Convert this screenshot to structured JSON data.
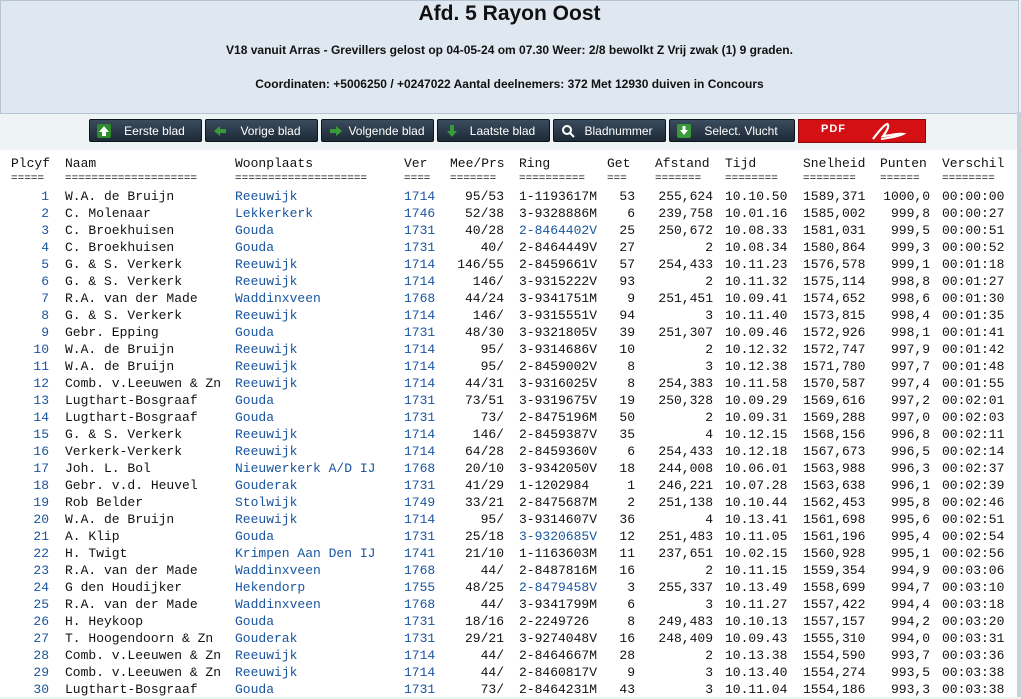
{
  "header": {
    "title": "Afd. 5 Rayon Oost",
    "line1": "V18 vanuit Arras - Grevillers gelost op 04-05-24 om 07.30 Weer: 2/8 bewolkt Z Vrij zwak (1) 9 graden.",
    "line2": "Coordinaten: +5006250 / +0247022 Aantal deelnemers: 372 Met 12930 duiven in Concours"
  },
  "toolbar": {
    "first": "Eerste blad",
    "prev": "Vorige blad",
    "next": "Volgende blad",
    "last": "Laatste blad",
    "page": "Bladnummer",
    "flight": "Select. Vlucht",
    "pdf": "PDF"
  },
  "table": {
    "columns": [
      "Plcyf",
      "Naam",
      "Woonplaats",
      "Ver",
      "Mee/Prs",
      "Ring",
      "Get",
      "Afstand",
      "Tijd",
      "Snelheid",
      "Punten",
      "Verschil"
    ],
    "separators": [
      "=====",
      "====================",
      "====================",
      "====",
      "=======",
      "==========",
      "===",
      "=======",
      "========",
      "========",
      "======",
      "========"
    ],
    "rows": [
      [
        "1",
        "W.A. de Bruijn",
        "Reeuwijk",
        "1714",
        "95/53",
        "1-1193617M",
        "53",
        "255,624",
        "10.10.50",
        "1589,371",
        "1000,0",
        "00:00:00"
      ],
      [
        "2",
        "C. Molenaar",
        "Lekkerkerk",
        "1746",
        "52/38",
        "3-9328886M",
        "6",
        "239,758",
        "10.01.16",
        "1585,002",
        "999,8",
        "00:00:27"
      ],
      [
        "3",
        "C. Broekhuisen",
        "Gouda",
        "1731",
        "40/28",
        "2-8464402V",
        "25",
        "250,672",
        "10.08.33",
        "1581,031",
        "999,5",
        "00:00:51"
      ],
      [
        "4",
        "C. Broekhuisen",
        "Gouda",
        "1731",
        "40/",
        "2-8464449V",
        "27",
        "2",
        "10.08.34",
        "1580,864",
        "999,3",
        "00:00:52"
      ],
      [
        "5",
        "G. & S. Verkerk",
        "Reeuwijk",
        "1714",
        "146/55",
        "2-8459661V",
        "57",
        "254,433",
        "10.11.23",
        "1576,578",
        "999,1",
        "00:01:18"
      ],
      [
        "6",
        "G. & S. Verkerk",
        "Reeuwijk",
        "1714",
        "146/",
        "3-9315222V",
        "93",
        "2",
        "10.11.32",
        "1575,114",
        "998,8",
        "00:01:27"
      ],
      [
        "7",
        "R.A. van der Made",
        "Waddinxveen",
        "1768",
        "44/24",
        "3-9341751M",
        "9",
        "251,451",
        "10.09.41",
        "1574,652",
        "998,6",
        "00:01:30"
      ],
      [
        "8",
        "G. & S. Verkerk",
        "Reeuwijk",
        "1714",
        "146/",
        "3-9315551V",
        "94",
        "3",
        "10.11.40",
        "1573,815",
        "998,4",
        "00:01:35"
      ],
      [
        "9",
        "Gebr. Epping",
        "Gouda",
        "1731",
        "48/30",
        "3-9321805V",
        "39",
        "251,307",
        "10.09.46",
        "1572,926",
        "998,1",
        "00:01:41"
      ],
      [
        "10",
        "W.A. de Bruijn",
        "Reeuwijk",
        "1714",
        "95/",
        "3-9314686V",
        "10",
        "2",
        "10.12.32",
        "1572,747",
        "997,9",
        "00:01:42"
      ],
      [
        "11",
        "W.A. de Bruijn",
        "Reeuwijk",
        "1714",
        "95/",
        "2-8459002V",
        "8",
        "3",
        "10.12.38",
        "1571,780",
        "997,7",
        "00:01:48"
      ],
      [
        "12",
        "Comb. v.Leeuwen & Zn",
        "Reeuwijk",
        "1714",
        "44/31",
        "3-9316025V",
        "8",
        "254,383",
        "10.11.58",
        "1570,587",
        "997,4",
        "00:01:55"
      ],
      [
        "13",
        "Lugthart-Bosgraaf",
        "Gouda",
        "1731",
        "73/51",
        "3-9319675V",
        "19",
        "250,328",
        "10.09.29",
        "1569,616",
        "997,2",
        "00:02:01"
      ],
      [
        "14",
        "Lugthart-Bosgraaf",
        "Gouda",
        "1731",
        "73/",
        "2-8475196M",
        "50",
        "2",
        "10.09.31",
        "1569,288",
        "997,0",
        "00:02:03"
      ],
      [
        "15",
        "G. & S. Verkerk",
        "Reeuwijk",
        "1714",
        "146/",
        "2-8459387V",
        "35",
        "4",
        "10.12.15",
        "1568,156",
        "996,8",
        "00:02:11"
      ],
      [
        "16",
        "Verkerk-Verkerk",
        "Reeuwijk",
        "1714",
        "64/28",
        "2-8459360V",
        "6",
        "254,433",
        "10.12.18",
        "1567,673",
        "996,5",
        "00:02:14"
      ],
      [
        "17",
        "Joh. L. Bol",
        "Nieuwerkerk A/D IJ",
        "1768",
        "20/10",
        "3-9342050V",
        "18",
        "244,008",
        "10.06.01",
        "1563,988",
        "996,3",
        "00:02:37"
      ],
      [
        "18",
        "Gebr. v.d. Heuvel",
        "Gouderak",
        "1731",
        "41/29",
        "1-1202984",
        "1",
        "246,221",
        "10.07.28",
        "1563,638",
        "996,1",
        "00:02:39"
      ],
      [
        "19",
        "Rob Belder",
        "Stolwijk",
        "1749",
        "33/21",
        "2-8475687M",
        "2",
        "251,138",
        "10.10.44",
        "1562,453",
        "995,8",
        "00:02:46"
      ],
      [
        "20",
        "W.A. de Bruijn",
        "Reeuwijk",
        "1714",
        "95/",
        "3-9314607V",
        "36",
        "4",
        "10.13.41",
        "1561,698",
        "995,6",
        "00:02:51"
      ],
      [
        "21",
        "A. Klip",
        "Gouda",
        "1731",
        "25/18",
        "3-9320685V",
        "12",
        "251,483",
        "10.11.05",
        "1561,196",
        "995,4",
        "00:02:54"
      ],
      [
        "22",
        "H. Twigt",
        "Krimpen Aan Den IJ",
        "1741",
        "21/10",
        "1-1163603M",
        "11",
        "237,651",
        "10.02.15",
        "1560,928",
        "995,1",
        "00:02:56"
      ],
      [
        "23",
        "R.A. van der Made",
        "Waddinxveen",
        "1768",
        "44/",
        "2-8487816M",
        "16",
        "2",
        "10.11.15",
        "1559,354",
        "994,9",
        "00:03:06"
      ],
      [
        "24",
        "G den Houdijker",
        "Hekendorp",
        "1755",
        "48/25",
        "2-8479458V",
        "3",
        "255,337",
        "10.13.49",
        "1558,699",
        "994,7",
        "00:03:10"
      ],
      [
        "25",
        "R.A. van der Made",
        "Waddinxveen",
        "1768",
        "44/",
        "3-9341799M",
        "6",
        "3",
        "10.11.27",
        "1557,422",
        "994,4",
        "00:03:18"
      ],
      [
        "26",
        "H. Heykoop",
        "Gouda",
        "1731",
        "18/16",
        "2-2249726",
        "8",
        "249,483",
        "10.10.13",
        "1557,157",
        "994,2",
        "00:03:20"
      ],
      [
        "27",
        "T. Hoogendoorn & Zn",
        "Gouderak",
        "1731",
        "29/21",
        "3-9274048V",
        "16",
        "248,409",
        "10.09.43",
        "1555,310",
        "994,0",
        "00:03:31"
      ],
      [
        "28",
        "Comb. v.Leeuwen & Zn",
        "Reeuwijk",
        "1714",
        "44/",
        "2-8464667M",
        "28",
        "2",
        "10.13.38",
        "1554,590",
        "993,7",
        "00:03:36"
      ],
      [
        "29",
        "Comb. v.Leeuwen & Zn",
        "Reeuwijk",
        "1714",
        "44/",
        "2-8460817V",
        "9",
        "3",
        "10.13.40",
        "1554,274",
        "993,5",
        "00:03:38"
      ],
      [
        "30",
        "Lugthart-Bosgraaf",
        "Gouda",
        "1731",
        "73/",
        "2-8464231M",
        "43",
        "3",
        "10.11.04",
        "1554,186",
        "993,3",
        "00:03:38"
      ]
    ],
    "blue_rings": [
      "2-8464402V",
      "3-9320685V",
      "2-8479458V"
    ]
  },
  "colors": {
    "link": "#1a55a0",
    "pdf": "#d41014",
    "header_bg": "#dfe8f1"
  }
}
